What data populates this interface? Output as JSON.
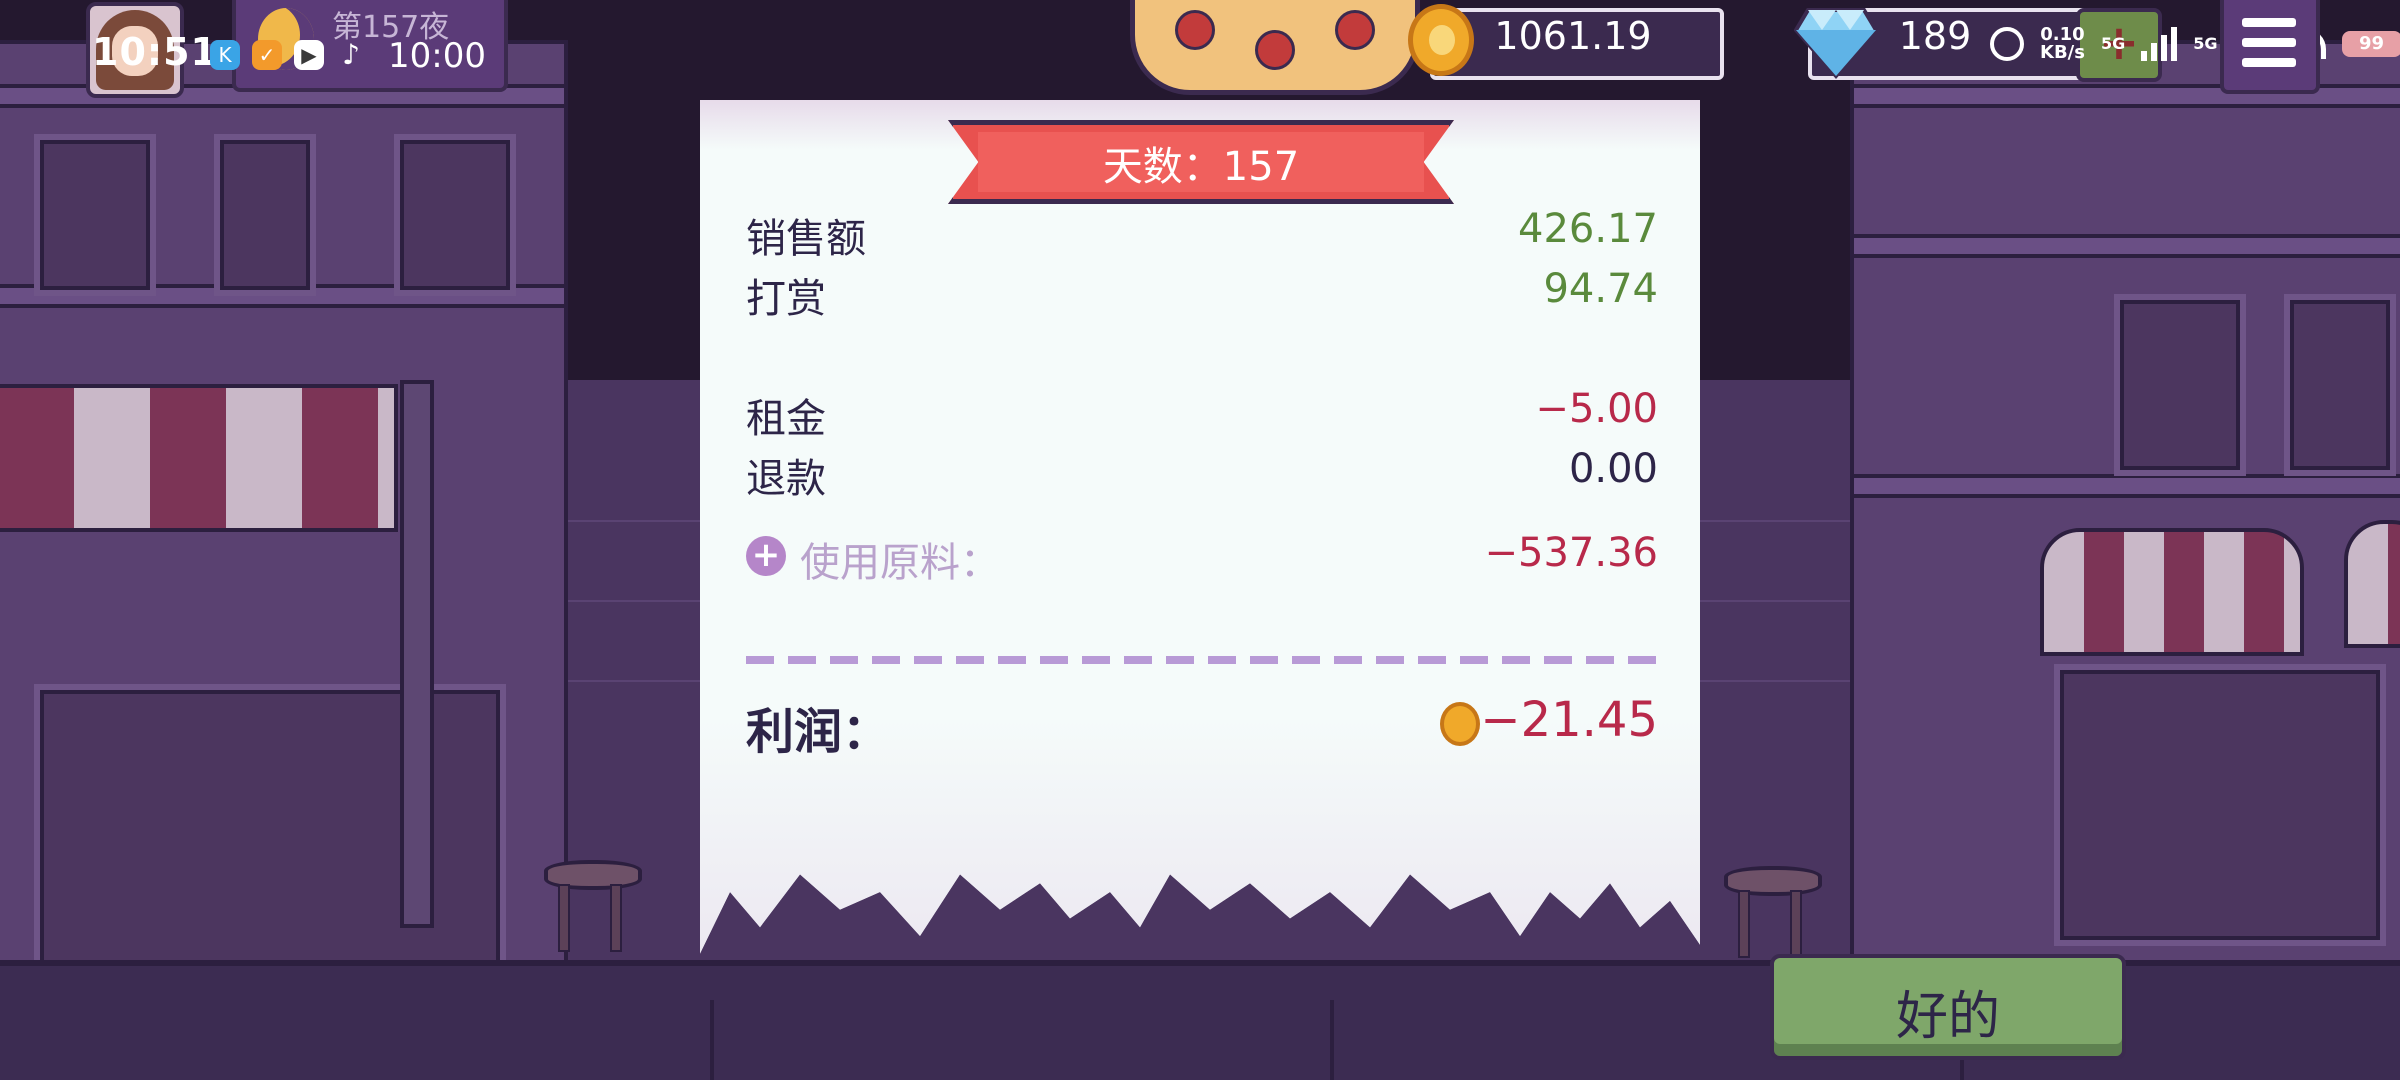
{
  "status_bar": {
    "clock": "10:51",
    "net_speed": "0.10",
    "net_unit": "KB/s",
    "net_type_1": "5G",
    "net_type_2": "5G",
    "battery": "99"
  },
  "hud": {
    "day_title": "第157夜",
    "time": "10:00",
    "coins": "1061.19",
    "gems": "189",
    "add_label": "+"
  },
  "receipt": {
    "banner": "天数：157",
    "rows": [
      {
        "label": "销售额",
        "value": "426.17"
      },
      {
        "label": "打赏",
        "value": "94.74"
      },
      {
        "label": "租金",
        "value": "−5.00"
      },
      {
        "label": "退款",
        "value": "0.00"
      }
    ],
    "ingredients": {
      "label": "使用原料：",
      "value": "−537.36"
    },
    "profit": {
      "label": "利润：",
      "value": "−21.45"
    }
  },
  "ok_button": "好的",
  "colors": {
    "positive": "#5a8a3c",
    "negative": "#b8294a",
    "neutral": "#2d2548",
    "ribbon": "#e8514f",
    "button": "#7fa76a"
  }
}
